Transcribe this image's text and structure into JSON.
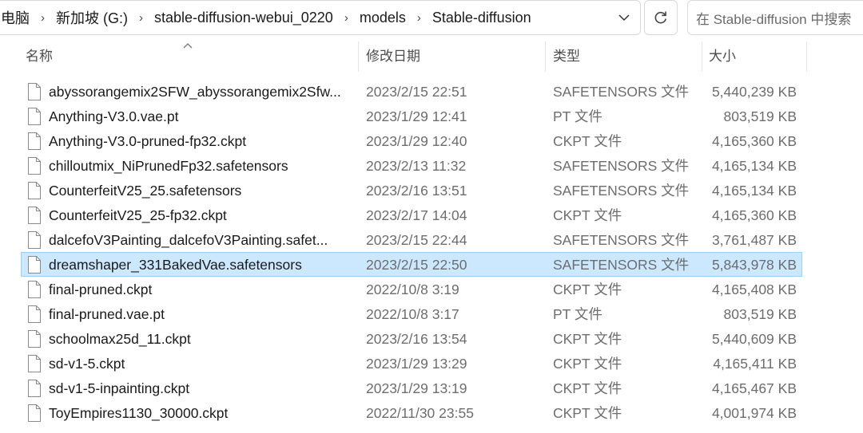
{
  "address": {
    "crumbs": [
      "电脑",
      "新加坡 (G:)",
      "stable-diffusion-webui_0220",
      "models",
      "Stable-diffusion"
    ],
    "separator": "›"
  },
  "search": {
    "placeholder": "在 Stable-diffusion 中搜索"
  },
  "columns": {
    "name": "名称",
    "date": "修改日期",
    "type": "类型",
    "size": "大小"
  },
  "selected_color": "#cce8ff",
  "files": [
    {
      "name": "abyssorangemix2SFW_abyssorangemix2Sfw...",
      "date": "2023/2/15 22:51",
      "type": "SAFETENSORS 文件",
      "size": "5,440,239 KB"
    },
    {
      "name": "Anything-V3.0.vae.pt",
      "date": "2023/1/29 12:41",
      "type": "PT 文件",
      "size": "803,519 KB"
    },
    {
      "name": "Anything-V3.0-pruned-fp32.ckpt",
      "date": "2023/1/29 12:40",
      "type": "CKPT 文件",
      "size": "4,165,360 KB"
    },
    {
      "name": "chilloutmix_NiPrunedFp32.safetensors",
      "date": "2023/2/13 11:32",
      "type": "SAFETENSORS 文件",
      "size": "4,165,134 KB"
    },
    {
      "name": "CounterfeitV25_25.safetensors",
      "date": "2023/2/16 13:51",
      "type": "SAFETENSORS 文件",
      "size": "4,165,134 KB"
    },
    {
      "name": "CounterfeitV25_25-fp32.ckpt",
      "date": "2023/2/17 14:04",
      "type": "CKPT 文件",
      "size": "4,165,360 KB"
    },
    {
      "name": "dalcefoV3Painting_dalcefoV3Painting.safet...",
      "date": "2023/2/15 22:44",
      "type": "SAFETENSORS 文件",
      "size": "3,761,487 KB"
    },
    {
      "name": "dreamshaper_331BakedVae.safetensors",
      "date": "2023/2/15 22:50",
      "type": "SAFETENSORS 文件",
      "size": "5,843,978 KB",
      "selected": true
    },
    {
      "name": "final-pruned.ckpt",
      "date": "2022/10/8 3:19",
      "type": "CKPT 文件",
      "size": "4,165,408 KB"
    },
    {
      "name": "final-pruned.vae.pt",
      "date": "2022/10/8 3:17",
      "type": "PT 文件",
      "size": "803,519 KB"
    },
    {
      "name": "schoolmax25d_11.ckpt",
      "date": "2023/2/16 13:54",
      "type": "CKPT 文件",
      "size": "5,440,609 KB"
    },
    {
      "name": "sd-v1-5.ckpt",
      "date": "2023/1/29 13:29",
      "type": "CKPT 文件",
      "size": "4,165,411 KB"
    },
    {
      "name": "sd-v1-5-inpainting.ckpt",
      "date": "2023/1/29 13:19",
      "type": "CKPT 文件",
      "size": "4,165,467 KB"
    },
    {
      "name": "ToyEmpires1130_30000.ckpt",
      "date": "2022/11/30 23:55",
      "type": "CKPT 文件",
      "size": "4,001,974 KB"
    }
  ]
}
